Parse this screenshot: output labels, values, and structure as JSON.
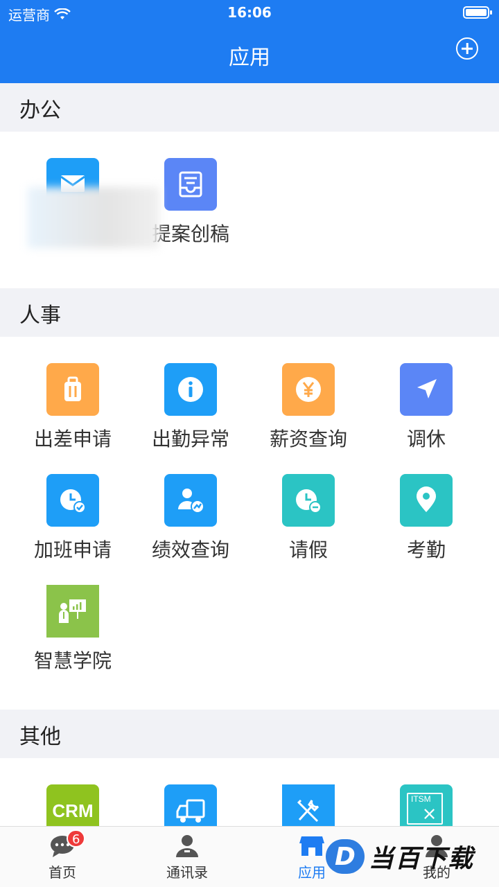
{
  "status_bar": {
    "carrier": "运营商",
    "time": "16:06"
  },
  "nav": {
    "title": "应用"
  },
  "sections": [
    {
      "title": "办公",
      "items": [
        {
          "label": "",
          "icon": "mail-icon",
          "color": "#1e9ef7"
        },
        {
          "label": "提案创稿",
          "icon": "inbox-tray-icon",
          "color": "#5b86f6"
        }
      ]
    },
    {
      "title": "人事",
      "items": [
        {
          "label": "出差申请",
          "icon": "suitcase-icon",
          "color": "#ffa94a"
        },
        {
          "label": "出勤异常",
          "icon": "info-icon",
          "color": "#1e9ef7"
        },
        {
          "label": "薪资查询",
          "icon": "yen-coin-icon",
          "color": "#ffa94a"
        },
        {
          "label": "调休",
          "icon": "navigation-arrow-icon",
          "color": "#5b86f6"
        },
        {
          "label": "加班申请",
          "icon": "clock-check-icon",
          "color": "#1e9ef7"
        },
        {
          "label": "绩效查询",
          "icon": "person-chart-icon",
          "color": "#1e9ef7"
        },
        {
          "label": "请假",
          "icon": "clock-minus-icon",
          "color": "#2bc4c4"
        },
        {
          "label": "考勤",
          "icon": "location-pin-icon",
          "color": "#2bc4c4"
        },
        {
          "label": "智慧学院",
          "icon": "presentation-icon",
          "color": "#8bc34a"
        }
      ]
    },
    {
      "title": "其他",
      "items": [
        {
          "label": "",
          "icon": "crm-icon",
          "color": "#8fc31f",
          "icon_text": "CRM"
        },
        {
          "label": "",
          "icon": "truck-icon",
          "color": "#1e9ef7"
        },
        {
          "label": "",
          "icon": "tools-icon",
          "color": "#1e9ef7"
        },
        {
          "label": "",
          "icon": "itsm-icon",
          "color": "#2bc4c4",
          "icon_text": "ITSM"
        }
      ]
    }
  ],
  "tabs": [
    {
      "label": "首页",
      "icon": "chat-bubble-icon",
      "badge": "6"
    },
    {
      "label": "通讯录",
      "icon": "contacts-person-icon"
    },
    {
      "label": "应用",
      "icon": "apps-store-icon",
      "active": true
    },
    {
      "label": "我的",
      "icon": "profile-icon"
    }
  ],
  "watermark": {
    "logo_letter": "D",
    "text": "当百下载"
  }
}
